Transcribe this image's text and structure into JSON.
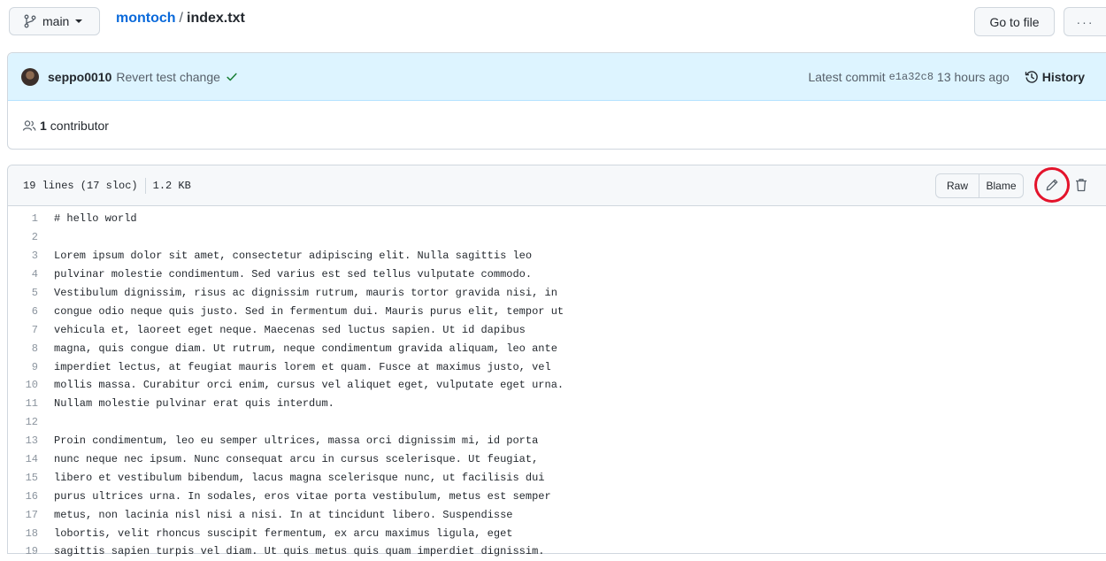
{
  "branch": {
    "name": "main"
  },
  "breadcrumb": {
    "repo": "montoch",
    "separator": "/",
    "file": "index.txt"
  },
  "toolbar": {
    "goto_file": "Go to file",
    "more": "···"
  },
  "commit": {
    "author": "seppo0010",
    "message": "Revert test change",
    "latest_label": "Latest commit",
    "sha": "e1a32c8",
    "time": "13 hours ago",
    "history_label": "History"
  },
  "contributors": {
    "count": "1",
    "label": "contributor"
  },
  "file": {
    "lines_info": "19 lines (17 sloc)",
    "size": "1.2 KB",
    "raw_label": "Raw",
    "blame_label": "Blame",
    "highlight_color": "#e3132b"
  },
  "code_lines": [
    {
      "n": "1",
      "text": "# hello world"
    },
    {
      "n": "2",
      "text": ""
    },
    {
      "n": "3",
      "text": "Lorem ipsum dolor sit amet, consectetur adipiscing elit. Nulla sagittis leo"
    },
    {
      "n": "4",
      "text": "pulvinar molestie condimentum. Sed varius est sed tellus vulputate commodo."
    },
    {
      "n": "5",
      "text": "Vestibulum dignissim, risus ac dignissim rutrum, mauris tortor gravida nisi, in"
    },
    {
      "n": "6",
      "text": "congue odio neque quis justo. Sed in fermentum dui. Mauris purus elit, tempor ut"
    },
    {
      "n": "7",
      "text": "vehicula et, laoreet eget neque. Maecenas sed luctus sapien. Ut id dapibus"
    },
    {
      "n": "8",
      "text": "magna, quis congue diam. Ut rutrum, neque condimentum gravida aliquam, leo ante"
    },
    {
      "n": "9",
      "text": "imperdiet lectus, at feugiat mauris lorem et quam. Fusce at maximus justo, vel"
    },
    {
      "n": "10",
      "text": "mollis massa. Curabitur orci enim, cursus vel aliquet eget, vulputate eget urna."
    },
    {
      "n": "11",
      "text": "Nullam molestie pulvinar erat quis interdum."
    },
    {
      "n": "12",
      "text": ""
    },
    {
      "n": "13",
      "text": "Proin condimentum, leo eu semper ultrices, massa orci dignissim mi, id porta"
    },
    {
      "n": "14",
      "text": "nunc neque nec ipsum. Nunc consequat arcu in cursus scelerisque. Ut feugiat,"
    },
    {
      "n": "15",
      "text": "libero et vestibulum bibendum, lacus magna scelerisque nunc, ut facilisis dui"
    },
    {
      "n": "16",
      "text": "purus ultrices urna. In sodales, eros vitae porta vestibulum, metus est semper"
    },
    {
      "n": "17",
      "text": "metus, non lacinia nisl nisi a nisi. In at tincidunt libero. Suspendisse"
    },
    {
      "n": "18",
      "text": "lobortis, velit rhoncus suscipit fermentum, ex arcu maximus ligula, eget"
    },
    {
      "n": "19",
      "text": "sagittis sapien turpis vel diam. Ut quis metus quis quam imperdiet dignissim."
    }
  ]
}
